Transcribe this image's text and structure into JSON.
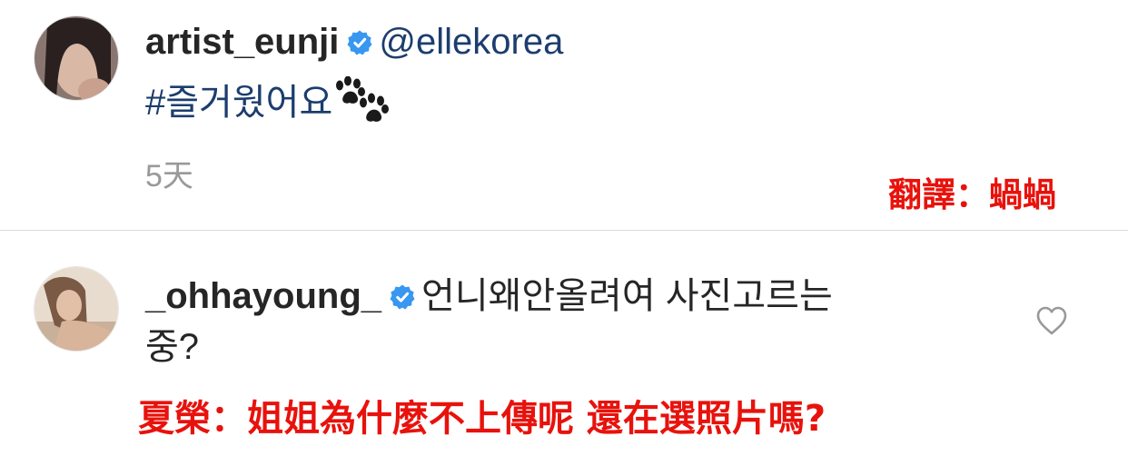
{
  "comments": [
    {
      "username": "artist_eunji",
      "mention": "@ellekorea",
      "hashtag": "#즐거웠어요",
      "emoji_icon": "paw-prints-icon",
      "time": "5天",
      "translation": "翻譯：蝸蝸"
    },
    {
      "username": "_ohhayoung_",
      "text_line1": "언니왜안올려여 사진고르는",
      "text_line2": "중?",
      "translation": "夏榮：姐姐為什麼不上傳呢 還在選照片嗎?"
    }
  ],
  "icons": {
    "verified": "verified-badge-icon",
    "like": "heart-outline-icon"
  },
  "colors": {
    "verified_blue": "#3897f0",
    "mention_blue": "#1c3d6e",
    "translation_red": "#e8120c",
    "timestamp_gray": "#999999",
    "divider_gray": "#dbdbdb"
  }
}
